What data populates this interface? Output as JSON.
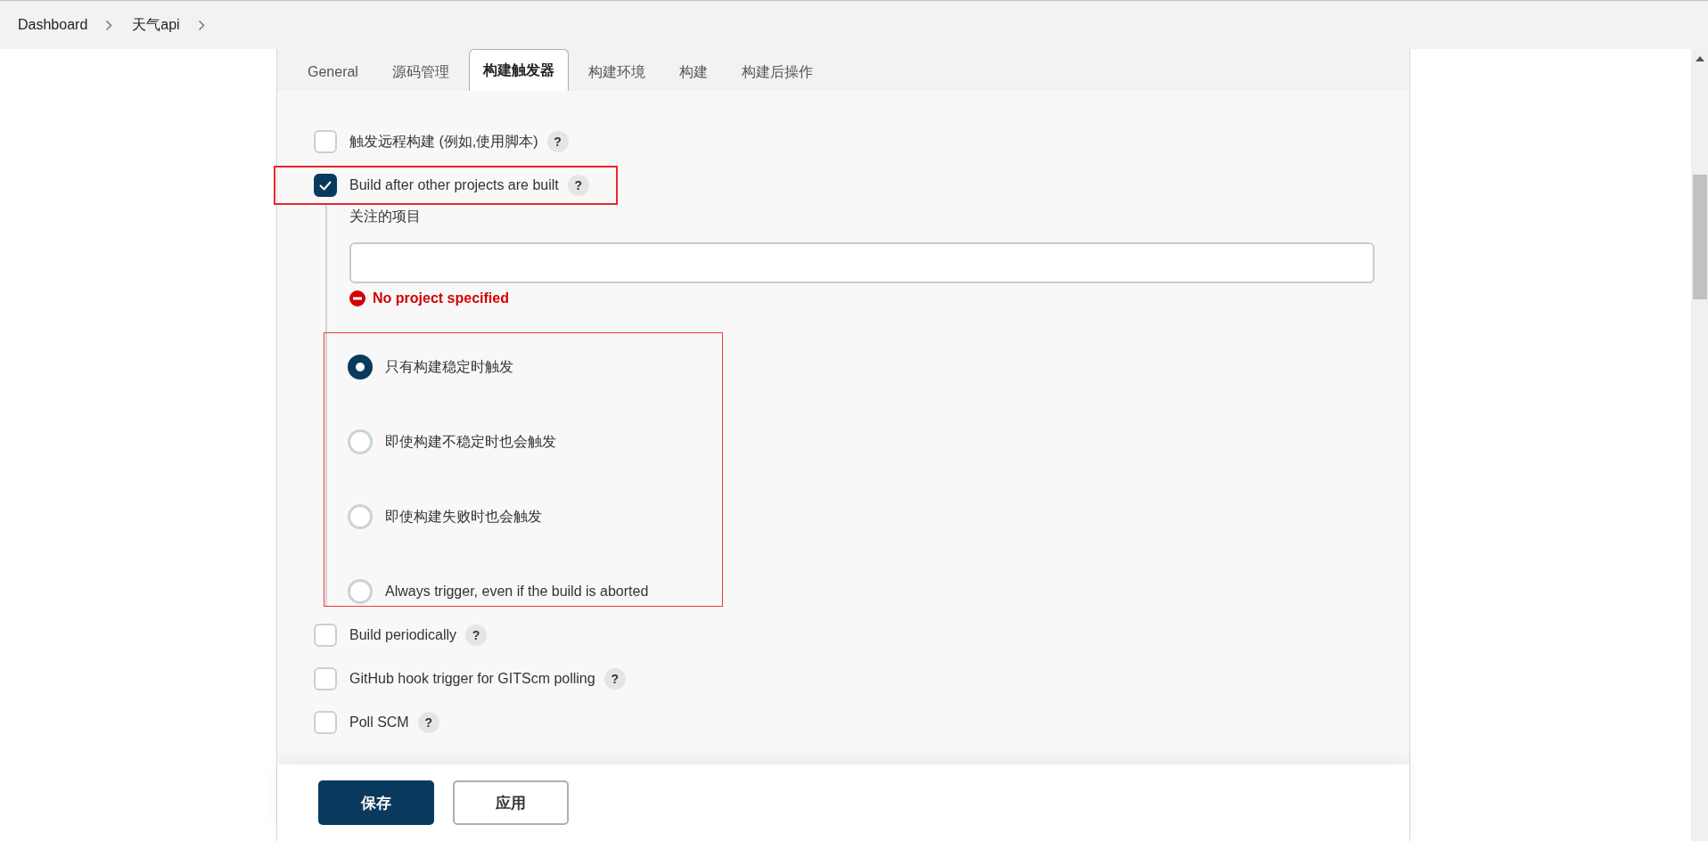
{
  "breadcrumb": [
    {
      "label": "Dashboard"
    },
    {
      "label": "天气api"
    }
  ],
  "tabs": [
    {
      "label": "General",
      "selected": false
    },
    {
      "label": "源码管理",
      "selected": false
    },
    {
      "label": "构建触发器",
      "selected": true
    },
    {
      "label": "构建环境",
      "selected": false
    },
    {
      "label": "构建",
      "selected": false
    },
    {
      "label": "构建后操作",
      "selected": false
    }
  ],
  "triggers": [
    {
      "label": "触发远程构建 (例如,使用脚本)",
      "help": "?",
      "checked": false,
      "highlighted": false
    },
    {
      "label": "Build after other projects are built",
      "help": "?",
      "checked": true,
      "highlighted": true,
      "details": {
        "field_label": "关注的项目",
        "error": "No project specified",
        "radios_highlighted": true,
        "radios": [
          {
            "label": "只有构建稳定时触发",
            "selected": true
          },
          {
            "label": "即使构建不稳定时也会触发",
            "selected": false
          },
          {
            "label": "即使构建失败时也会触发",
            "selected": false
          },
          {
            "label": "Always trigger, even if the build is aborted",
            "selected": false
          }
        ]
      }
    },
    {
      "label": "Build periodically",
      "help": "?",
      "checked": false,
      "highlighted": false
    },
    {
      "label": "GitHub hook trigger for GITScm polling",
      "help": "?",
      "checked": false,
      "highlighted": false
    },
    {
      "label": "Poll SCM",
      "help": "?",
      "checked": false,
      "highlighted": false
    }
  ],
  "buttons": [
    {
      "label": "保存",
      "kind": "primary"
    },
    {
      "label": "应用",
      "kind": "secondary"
    }
  ]
}
